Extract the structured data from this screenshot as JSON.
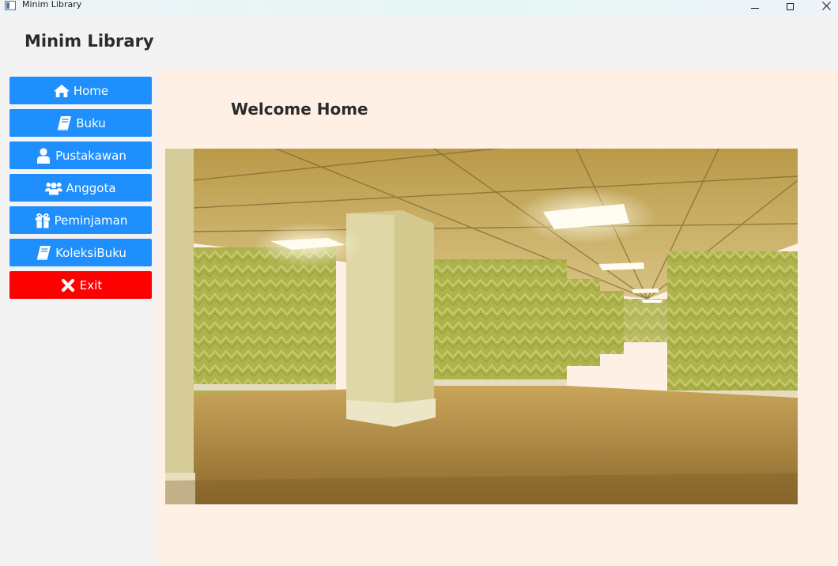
{
  "window": {
    "title": "Minim Library"
  },
  "app": {
    "name": "Minim Library"
  },
  "sidebar": {
    "items": [
      {
        "label": "Home",
        "icon": "home-icon"
      },
      {
        "label": "Buku",
        "icon": "book-icon"
      },
      {
        "label": "Pustakawan",
        "icon": "user-icon"
      },
      {
        "label": "Anggota",
        "icon": "users-icon"
      },
      {
        "label": "Peminjaman",
        "icon": "gift-icon"
      },
      {
        "label": "KoleksiBuku",
        "icon": "book-icon"
      },
      {
        "label": "Exit",
        "icon": "close-icon"
      }
    ]
  },
  "main": {
    "heading": "Welcome Home"
  },
  "colors": {
    "nav_button": "#1e8ffc",
    "exit_button": "#fd0000",
    "content_bg": "#fef0e4",
    "sidebar_bg": "#f3f3f4"
  }
}
